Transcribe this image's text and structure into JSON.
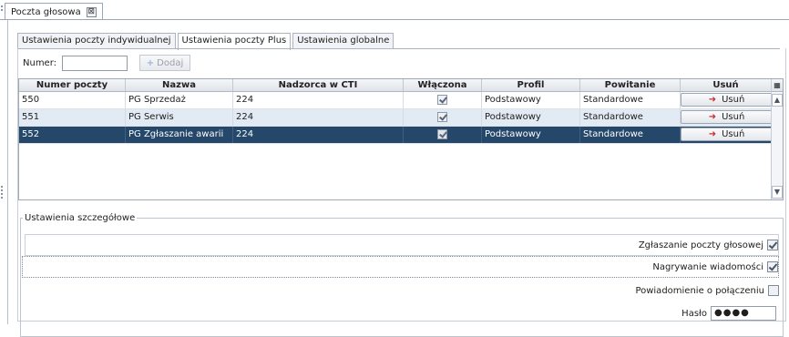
{
  "window_tab": {
    "title": "Poczta głosowa",
    "close_glyph": "⊠"
  },
  "subtabs": [
    {
      "label": "Ustawienia poczty indywidualnej"
    },
    {
      "label": "Ustawienia poczty Plus"
    },
    {
      "label": "Ustawienia globalne"
    }
  ],
  "numer": {
    "label": "Numer:",
    "value": "",
    "add_label": "Dodaj"
  },
  "table": {
    "headers": [
      "Numer poczty",
      "Nazwa",
      "Nadzorca w CTI",
      "Włączona",
      "Profil",
      "Powitanie",
      "Usuń"
    ],
    "rows": [
      {
        "numer": "550",
        "nazwa": "PG Sprzedaż",
        "nadzorca": "224",
        "wlaczona": true,
        "profil": "Podstawowy",
        "powitanie": "Standardowe",
        "usun": "Usuń"
      },
      {
        "numer": "551",
        "nazwa": "PG Serwis",
        "nadzorca": "224",
        "wlaczona": true,
        "profil": "Podstawowy",
        "powitanie": "Standardowe",
        "usun": "Usuń"
      },
      {
        "numer": "552",
        "nazwa": "PG Zgłaszanie awarii",
        "nadzorca": "224",
        "wlaczona": true,
        "profil": "Podstawowy",
        "powitanie": "Standardowe",
        "usun": "Usuń"
      }
    ],
    "selected_row": 2
  },
  "details": {
    "legend": "Ustawienia szczegółowe",
    "zglaszanie": {
      "label": "Zgłaszanie poczty głosowej",
      "checked": true
    },
    "nagrywanie": {
      "label": "Nagrywanie wiadomości",
      "checked": true
    },
    "powiadomienie": {
      "label": "Powiadomienie o połączeniu",
      "checked": false
    },
    "haslo": {
      "label": "Hasło",
      "value": "●●●●"
    }
  },
  "colors": {
    "selected_row": "#24476a",
    "alt_row": "#e2eaf3",
    "delete_icon": "#c9302c"
  },
  "icons": {
    "add": "plus-icon",
    "delete": "delete-icon",
    "column_chooser": "column-chooser-icon"
  }
}
